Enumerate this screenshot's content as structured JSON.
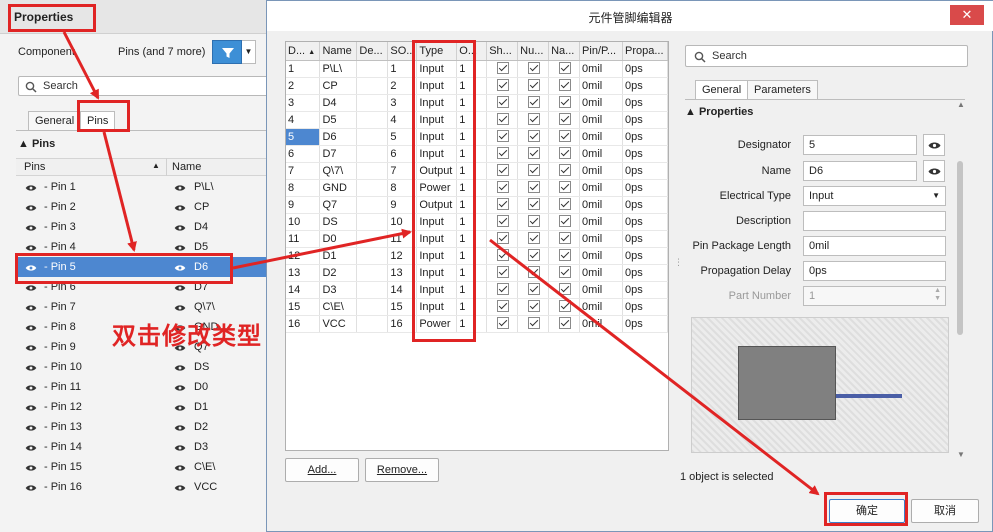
{
  "properties": {
    "title": "Properties",
    "component_label": "Component",
    "filter_label": "Pins (and 7 more)",
    "search_placeholder": "Search",
    "tabs": [
      "General",
      "Pins"
    ],
    "section": "Pins",
    "col_pins": "Pins",
    "col_name": "Name",
    "rows": [
      {
        "pin": "- Pin 1",
        "name": "P\\L\\"
      },
      {
        "pin": "- Pin 2",
        "name": "CP"
      },
      {
        "pin": "- Pin 3",
        "name": "D4"
      },
      {
        "pin": "- Pin 4",
        "name": "D5"
      },
      {
        "pin": "- Pin 5",
        "name": "D6"
      },
      {
        "pin": "- Pin 6",
        "name": "D7"
      },
      {
        "pin": "- Pin 7",
        "name": "Q\\7\\"
      },
      {
        "pin": "- Pin 8",
        "name": "GND"
      },
      {
        "pin": "- Pin 9",
        "name": "Q7"
      },
      {
        "pin": "- Pin 10",
        "name": "DS"
      },
      {
        "pin": "- Pin 11",
        "name": "D0"
      },
      {
        "pin": "- Pin 12",
        "name": "D1"
      },
      {
        "pin": "- Pin 13",
        "name": "D2"
      },
      {
        "pin": "- Pin 14",
        "name": "D3"
      },
      {
        "pin": "- Pin 15",
        "name": "C\\E\\"
      },
      {
        "pin": "- Pin 16",
        "name": "VCC"
      }
    ]
  },
  "dialog": {
    "title": "元件管脚编辑器",
    "close_glyph": "✕",
    "columns": [
      "D...",
      "Name",
      "De...",
      "SO...",
      "Type",
      "O...",
      "Sh...",
      "Nu...",
      "Na...",
      "Pin/P...",
      "Propa..."
    ],
    "rows": [
      {
        "d": "1",
        "name": "P\\L\\",
        "so": "1",
        "type": "Input",
        "o": "1",
        "len": "0mil",
        "prop": "0ps"
      },
      {
        "d": "2",
        "name": "CP",
        "so": "2",
        "type": "Input",
        "o": "1",
        "len": "0mil",
        "prop": "0ps"
      },
      {
        "d": "3",
        "name": "D4",
        "so": "3",
        "type": "Input",
        "o": "1",
        "len": "0mil",
        "prop": "0ps"
      },
      {
        "d": "4",
        "name": "D5",
        "so": "4",
        "type": "Input",
        "o": "1",
        "len": "0mil",
        "prop": "0ps"
      },
      {
        "d": "5",
        "name": "D6",
        "so": "5",
        "type": "Input",
        "o": "1",
        "len": "0mil",
        "prop": "0ps"
      },
      {
        "d": "6",
        "name": "D7",
        "so": "6",
        "type": "Input",
        "o": "1",
        "len": "0mil",
        "prop": "0ps"
      },
      {
        "d": "7",
        "name": "Q\\7\\",
        "so": "7",
        "type": "Output",
        "o": "1",
        "len": "0mil",
        "prop": "0ps"
      },
      {
        "d": "8",
        "name": "GND",
        "so": "8",
        "type": "Power",
        "o": "1",
        "len": "0mil",
        "prop": "0ps"
      },
      {
        "d": "9",
        "name": "Q7",
        "so": "9",
        "type": "Output",
        "o": "1",
        "len": "0mil",
        "prop": "0ps"
      },
      {
        "d": "10",
        "name": "DS",
        "so": "10",
        "type": "Input",
        "o": "1",
        "len": "0mil",
        "prop": "0ps"
      },
      {
        "d": "11",
        "name": "D0",
        "so": "11",
        "type": "Input",
        "o": "1",
        "len": "0mil",
        "prop": "0ps"
      },
      {
        "d": "12",
        "name": "D1",
        "so": "12",
        "type": "Input",
        "o": "1",
        "len": "0mil",
        "prop": "0ps"
      },
      {
        "d": "13",
        "name": "D2",
        "so": "13",
        "type": "Input",
        "o": "1",
        "len": "0mil",
        "prop": "0ps"
      },
      {
        "d": "14",
        "name": "D3",
        "so": "14",
        "type": "Input",
        "o": "1",
        "len": "0mil",
        "prop": "0ps"
      },
      {
        "d": "15",
        "name": "C\\E\\",
        "so": "15",
        "type": "Input",
        "o": "1",
        "len": "0mil",
        "prop": "0ps"
      },
      {
        "d": "16",
        "name": "VCC",
        "so": "16",
        "type": "Power",
        "o": "1",
        "len": "0mil",
        "prop": "0ps"
      }
    ],
    "selected_row": 4,
    "add_label": "Add...",
    "remove_label": "Remove...",
    "search_placeholder": "Search",
    "tabs": [
      "General",
      "Parameters"
    ],
    "section": "Properties",
    "fields": {
      "designator_label": "Designator",
      "designator": "5",
      "name_label": "Name",
      "name": "D6",
      "etype_label": "Electrical Type",
      "etype": "Input",
      "desc_label": "Description",
      "desc": "",
      "pkg_label": "Pin Package Length",
      "pkg": "0mil",
      "delay_label": "Propagation Delay",
      "delay": "0ps",
      "part_label": "Part Number",
      "part": "1"
    },
    "status": "1 object is selected",
    "ok_label": "确定",
    "cancel_label": "取消"
  },
  "annotation": {
    "text": "双击修改类型",
    "color": "#e02424"
  }
}
